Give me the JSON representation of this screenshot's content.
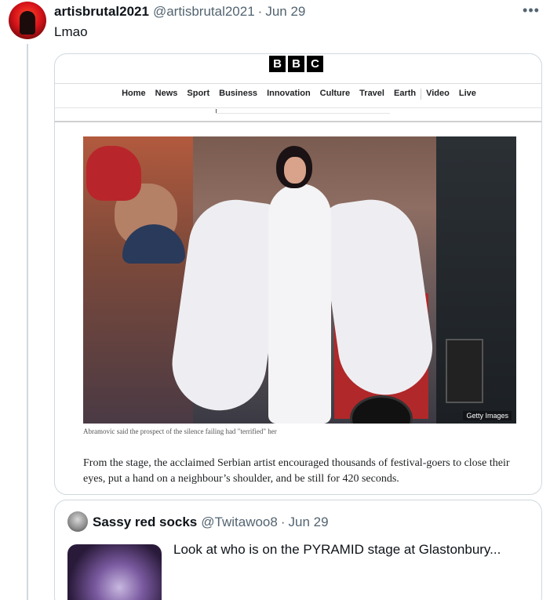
{
  "tweet": {
    "display_name": "artisbrutal2021",
    "handle": "@artisbrutal2021",
    "separator": "·",
    "date": "Jun 29",
    "text": "Lmao",
    "more_icon": "more-horizontal-icon"
  },
  "media": {
    "logo_letters": [
      "B",
      "B",
      "C"
    ],
    "nav": [
      "Home",
      "News",
      "Sport",
      "Business",
      "Innovation",
      "Culture",
      "Travel",
      "Earth",
      "Video",
      "Live"
    ],
    "photo_credit": "Getty Images",
    "caption": "Abramovic said the prospect of the silence failing had \"terrified\" her",
    "body": "From the stage, the acclaimed Serbian artist encouraged thousands of festival-goers to close their eyes, put a hand on a neighbour’s shoulder, and be still for 420 seconds."
  },
  "quoted": {
    "display_name": "Sassy red socks",
    "handle": "@Twitawoo8",
    "separator": "·",
    "date": "Jun 29",
    "text": "Look at who is on the PYRAMID stage at Glastonbury..."
  }
}
